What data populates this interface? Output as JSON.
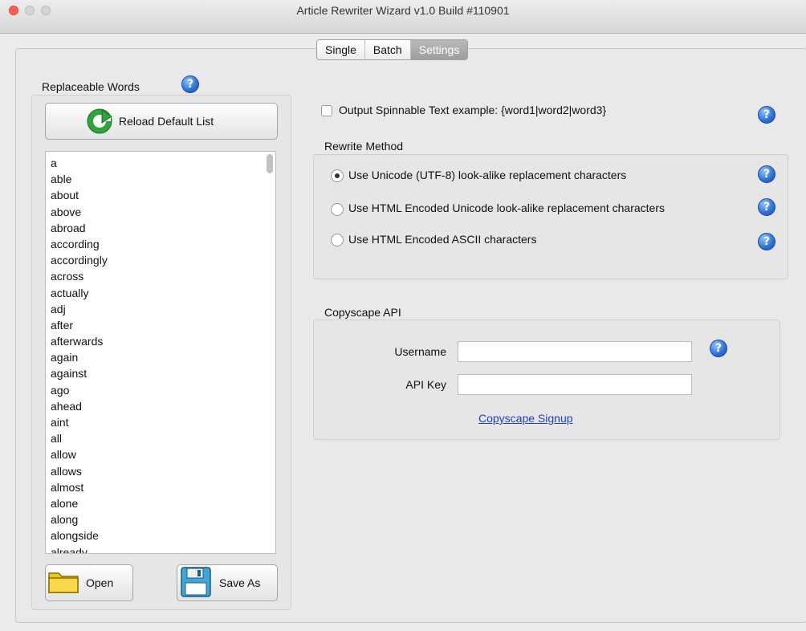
{
  "window": {
    "title": "Article Rewriter Wizard v1.0 Build #110901"
  },
  "tabs": [
    {
      "label": "Single"
    },
    {
      "label": "Batch"
    },
    {
      "label": "Settings"
    }
  ],
  "replaceable": {
    "label": "Replaceable Words",
    "help": "?",
    "reload_label": "Reload Default List",
    "words": [
      "a",
      "able",
      "about",
      "above",
      "abroad",
      "according",
      "accordingly",
      "across",
      "actually",
      "adj",
      "after",
      "afterwards",
      "again",
      "against",
      "ago",
      "ahead",
      "aint",
      "all",
      "allow",
      "allows",
      "almost",
      "alone",
      "along",
      "alongside",
      "already"
    ],
    "open_label": "Open",
    "save_label": "Save As"
  },
  "output": {
    "label": "Output Spinnable Text  example: {word1|word2|word3}",
    "checked": false,
    "help": "?"
  },
  "rewrite": {
    "label": "Rewrite Method",
    "options": [
      {
        "label": "Use Unicode (UTF-8) look-alike replacement characters",
        "selected": true,
        "help": "?"
      },
      {
        "label": "Use HTML Encoded Unicode look-alike replacement characters",
        "selected": false,
        "help": "?"
      },
      {
        "label": "Use HTML Encoded ASCII characters",
        "selected": false,
        "help": "?"
      }
    ]
  },
  "copyscape": {
    "label": "Copyscape API",
    "username_label": "Username",
    "username_value": "",
    "apikey_label": "API Key",
    "apikey_value": "",
    "help": "?",
    "signup_link": "Copyscape Signup"
  }
}
